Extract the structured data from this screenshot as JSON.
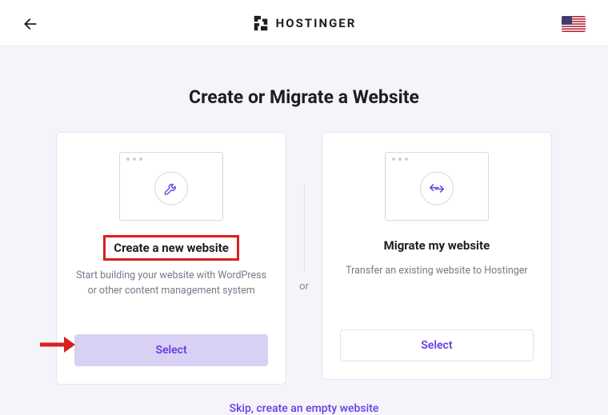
{
  "brand": "HOSTINGER",
  "pageTitle": "Create or Migrate a Website",
  "orLabel": "or",
  "card1": {
    "title": "Create a new website",
    "desc": "Start building your website with WordPress or other content management system",
    "button": "Select"
  },
  "card2": {
    "title": "Migrate my website",
    "desc": "Transfer an existing website to Hostinger",
    "button": "Select"
  },
  "skip": "Skip, create an empty website",
  "colors": {
    "accent": "#673de6",
    "annotationRed": "#d9201e"
  }
}
